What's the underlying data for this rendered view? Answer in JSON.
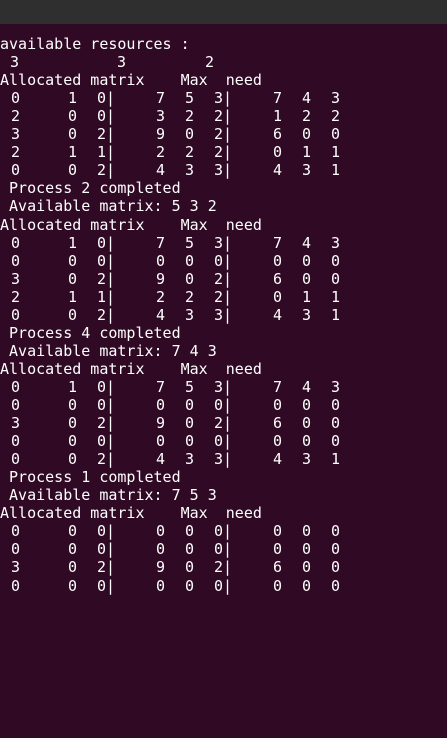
{
  "terminal": {
    "available_label": "available resources :",
    "available_values": [
      "3",
      "3",
      "2"
    ],
    "blocks": [
      {
        "header": "Allocated matrix    Max  need",
        "rows": [
          [
            "0",
            "1",
            "0|",
            "7",
            "5",
            "3|",
            "7",
            "4",
            "3"
          ],
          [
            "2",
            "0",
            "0|",
            "3",
            "2",
            "2|",
            "1",
            "2",
            "2"
          ],
          [
            "3",
            "0",
            "2|",
            "9",
            "0",
            "2|",
            "6",
            "0",
            "0"
          ],
          [
            "2",
            "1",
            "1|",
            "2",
            "2",
            "2|",
            "0",
            "1",
            "1"
          ],
          [
            "0",
            "0",
            "2|",
            "4",
            "3",
            "3|",
            "4",
            "3",
            "1"
          ]
        ],
        "completed": " Process 2 completed",
        "available": " Available matrix: 5 3 2"
      },
      {
        "header": "Allocated matrix    Max  need",
        "rows": [
          [
            "0",
            "1",
            "0|",
            "7",
            "5",
            "3|",
            "7",
            "4",
            "3"
          ],
          [
            "0",
            "0",
            "0|",
            "0",
            "0",
            "0|",
            "0",
            "0",
            "0"
          ],
          [
            "3",
            "0",
            "2|",
            "9",
            "0",
            "2|",
            "6",
            "0",
            "0"
          ],
          [
            "2",
            "1",
            "1|",
            "2",
            "2",
            "2|",
            "0",
            "1",
            "1"
          ],
          [
            "0",
            "0",
            "2|",
            "4",
            "3",
            "3|",
            "4",
            "3",
            "1"
          ]
        ],
        "completed": " Process 4 completed",
        "available": " Available matrix: 7 4 3"
      },
      {
        "header": "Allocated matrix    Max  need",
        "rows": [
          [
            "0",
            "1",
            "0|",
            "7",
            "5",
            "3|",
            "7",
            "4",
            "3"
          ],
          [
            "0",
            "0",
            "0|",
            "0",
            "0",
            "0|",
            "0",
            "0",
            "0"
          ],
          [
            "3",
            "0",
            "2|",
            "9",
            "0",
            "2|",
            "6",
            "0",
            "0"
          ],
          [
            "0",
            "0",
            "0|",
            "0",
            "0",
            "0|",
            "0",
            "0",
            "0"
          ],
          [
            "0",
            "0",
            "2|",
            "4",
            "3",
            "3|",
            "4",
            "3",
            "1"
          ]
        ],
        "completed": " Process 1 completed",
        "available": " Available matrix: 7 5 3"
      },
      {
        "header": "Allocated matrix    Max  need",
        "rows": [
          [
            "0",
            "0",
            "0|",
            "0",
            "0",
            "0|",
            "0",
            "0",
            "0"
          ],
          [
            "0",
            "0",
            "0|",
            "0",
            "0",
            "0|",
            "0",
            "0",
            "0"
          ],
          [
            "3",
            "0",
            "2|",
            "9",
            "0",
            "2|",
            "6",
            "0",
            "0"
          ],
          [
            "0",
            "0",
            "0|",
            "0",
            "0",
            "0|",
            "0",
            "0",
            "0"
          ]
        ],
        "completed": "",
        "available": ""
      }
    ]
  }
}
